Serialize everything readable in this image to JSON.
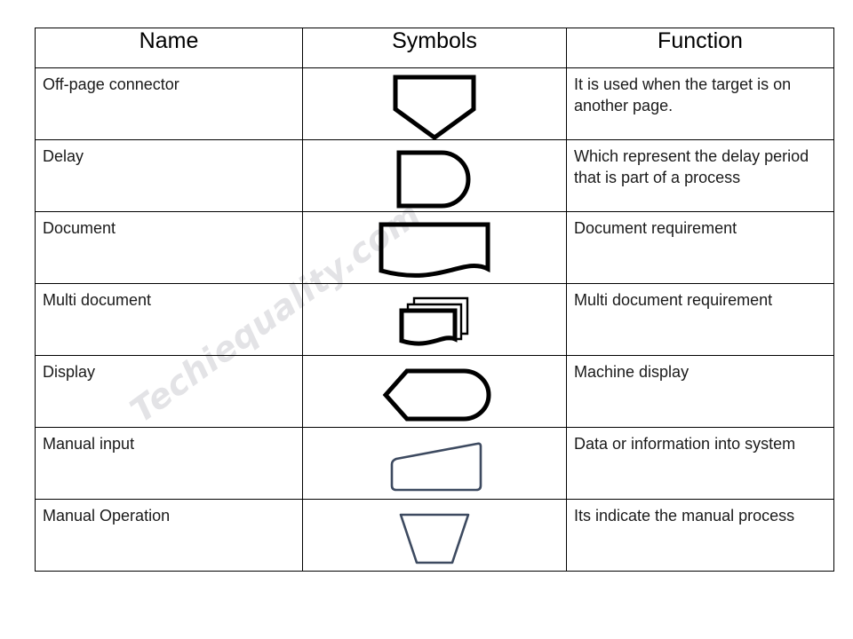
{
  "watermark": {
    "text": "Techiequality.com",
    "color": "#e3e3e6"
  },
  "colors": {
    "header_background": "#FFFF00",
    "border": "#000000",
    "text": "#1a1a1a",
    "symbol_black": "#000000",
    "symbol_navy": "#3d4a60"
  },
  "table": {
    "headers": {
      "name": "Name",
      "symbols": "Symbols",
      "function": "Function"
    },
    "rows": [
      {
        "name": "Off-page connector",
        "symbol": "off-page-connector-symbol",
        "function": "It is used when the target is on another page."
      },
      {
        "name": "Delay",
        "symbol": "delay-symbol",
        "function": "Which represent the delay period that is part of a process"
      },
      {
        "name": "Document",
        "symbol": "document-symbol",
        "function": "Document requirement"
      },
      {
        "name": "Multi document",
        "symbol": "multi-document-symbol",
        "function": "Multi document requirement"
      },
      {
        "name": "Display",
        "symbol": "display-symbol",
        "function": "Machine display"
      },
      {
        "name": "Manual input",
        "symbol": "manual-input-symbol",
        "function": "Data or information into system"
      },
      {
        "name": "Manual Operation",
        "symbol": "manual-operation-symbol",
        "function": "Its indicate the manual process"
      }
    ]
  }
}
